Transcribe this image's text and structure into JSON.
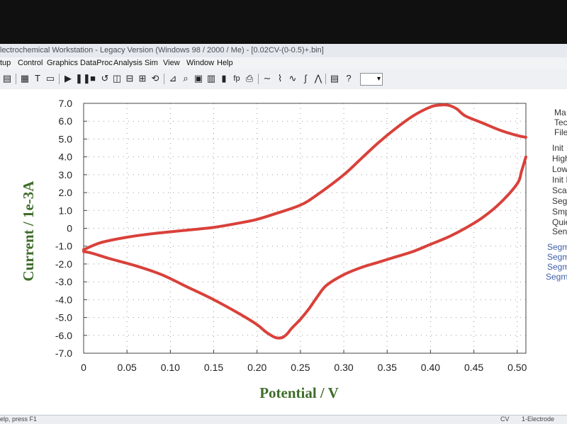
{
  "window": {
    "title": "lectrochemical Workstation - Legacy Version (Windows 98 / 2000 / Me) - [0.02CV-(0-0.5)+.bin]"
  },
  "menu": [
    "tup",
    "Control",
    "Graphics",
    "DataProc",
    "Analysis",
    "Sim",
    "View",
    "Window",
    "Help"
  ],
  "toolbar": {
    "icons": [
      "open-icon",
      "setup-icon",
      "text-icon",
      "template-icon",
      "run-icon",
      "pause-icon",
      "stop-icon",
      "reverse-icon",
      "ir-comp-icon",
      "filter-icon",
      "cell-icon",
      "zoom-icon",
      "overlay-icon",
      "color-icon",
      "fp-icon",
      "print-icon",
      "smooth-icon",
      "derivative-icon",
      "integrate-icon",
      "peak-icon",
      "report-icon",
      "help-icon",
      "dropdown"
    ],
    "combo_value": ""
  },
  "right_panel": {
    "labels": [
      "Ma",
      "Tec",
      "File",
      "Init",
      "High",
      "Low",
      "Init I",
      "Scan",
      "Segm",
      "Smpl",
      "Quiet",
      "Sens"
    ],
    "links": [
      "Segm",
      "Segm",
      "Segm",
      "Segm"
    ]
  },
  "status": {
    "left": "elp, press F1",
    "mid": "CV",
    "right": "1-Electrode"
  },
  "chart_data": {
    "type": "line",
    "xlabel": "Potential / V",
    "ylabel": "Current / 1e-3A",
    "xlim": [
      0,
      0.51
    ],
    "ylim": [
      -7.0,
      7.0
    ],
    "xticks": [
      "0",
      "0.05",
      "0.10",
      "0.15",
      "0.20",
      "0.25",
      "0.30",
      "0.35",
      "0.40",
      "0.45",
      "0.50"
    ],
    "yticks": [
      "7.0",
      "6.0",
      "5.0",
      "4.0",
      "3.0",
      "2.0",
      "1.0",
      "0",
      "-1.0",
      "-2.0",
      "-3.0",
      "-4.0",
      "-5.0",
      "-6.0",
      "-7.0"
    ],
    "grid": true,
    "line_color": "#d9413a",
    "series": [
      {
        "x": [
          0.0,
          0.02,
          0.05,
          0.08,
          0.12,
          0.15,
          0.18,
          0.2,
          0.22,
          0.25,
          0.27,
          0.3,
          0.32,
          0.34,
          0.36,
          0.38,
          0.4,
          0.41,
          0.42,
          0.43,
          0.44,
          0.46,
          0.48,
          0.5,
          0.51
        ],
        "y": [
          -1.2,
          -0.8,
          -0.5,
          -0.3,
          -0.1,
          0.05,
          0.3,
          0.5,
          0.8,
          1.3,
          1.9,
          3.0,
          3.9,
          4.8,
          5.6,
          6.3,
          6.8,
          6.9,
          6.9,
          6.7,
          6.3,
          5.9,
          5.5,
          5.2,
          5.1
        ]
      },
      {
        "x": [
          0.51,
          0.505,
          0.5,
          0.48,
          0.46,
          0.44,
          0.42,
          0.4,
          0.38,
          0.36,
          0.34,
          0.32,
          0.3,
          0.28,
          0.27,
          0.26,
          0.25,
          0.24,
          0.235,
          0.23,
          0.225,
          0.22,
          0.21,
          0.2,
          0.18,
          0.15,
          0.12,
          0.09,
          0.06,
          0.03,
          0.01,
          0.0
        ],
        "y": [
          4.0,
          3.2,
          2.5,
          1.4,
          0.6,
          0.0,
          -0.5,
          -0.9,
          -1.3,
          -1.6,
          -1.9,
          -2.2,
          -2.6,
          -3.2,
          -3.8,
          -4.5,
          -5.1,
          -5.6,
          -5.9,
          -6.1,
          -6.15,
          -6.1,
          -5.8,
          -5.4,
          -4.8,
          -4.0,
          -3.3,
          -2.6,
          -2.1,
          -1.7,
          -1.4,
          -1.3
        ]
      }
    ]
  }
}
